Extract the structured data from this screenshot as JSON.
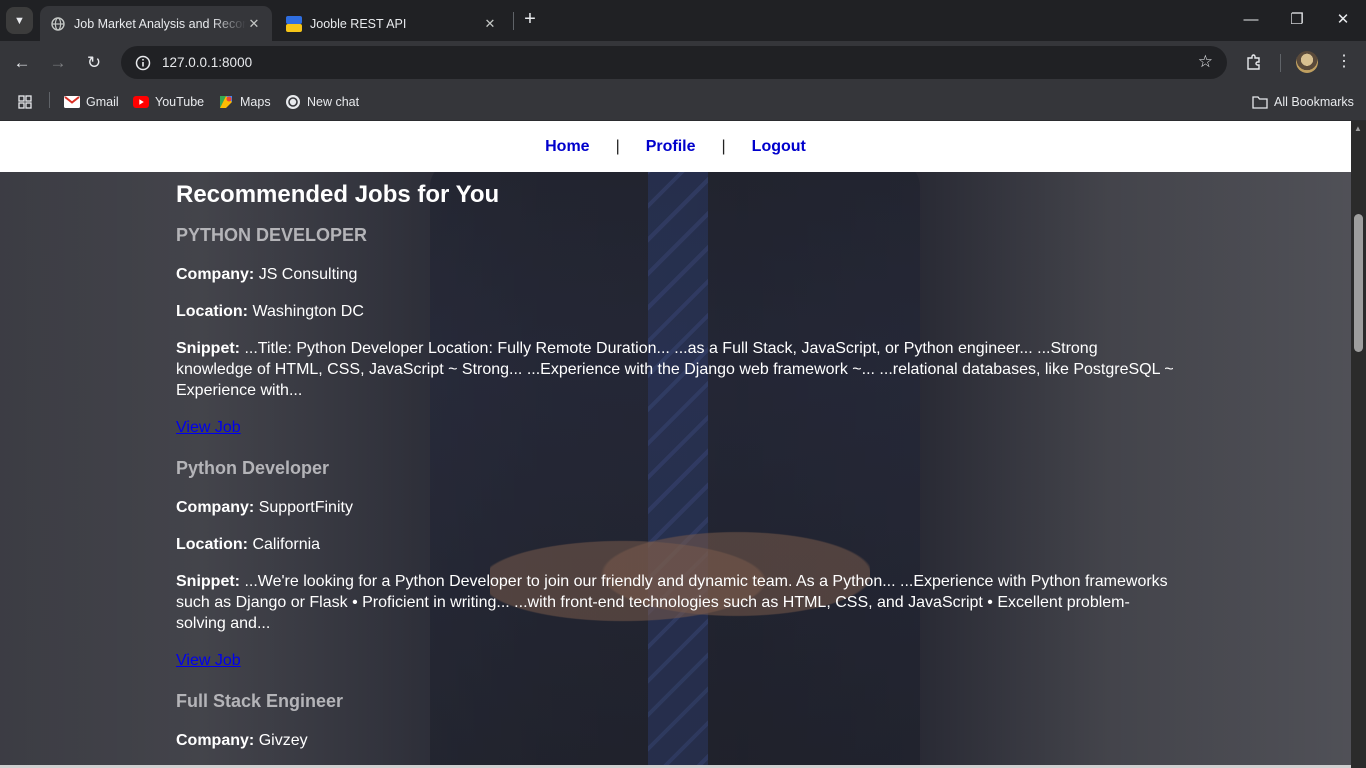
{
  "browser": {
    "tabs": [
      {
        "title": "Job Market Analysis and Recommendations",
        "active": true
      },
      {
        "title": "Jooble REST API",
        "active": false
      }
    ],
    "url": "127.0.0.1:8000",
    "bookmarks": [
      {
        "label": "Gmail",
        "icon": "gmail-icon"
      },
      {
        "label": "YouTube",
        "icon": "youtube-icon"
      },
      {
        "label": "Maps",
        "icon": "maps-icon"
      },
      {
        "label": "New chat",
        "icon": "chatgpt-icon"
      }
    ],
    "all_bookmarks": "All Bookmarks"
  },
  "nav": {
    "home": "Home",
    "profile": "Profile",
    "logout": "Logout",
    "separator": "|"
  },
  "page": {
    "heading": "Recommended Jobs for You",
    "labels": {
      "company": "Company:",
      "location": "Location:",
      "snippet": "Snippet:",
      "view_job": "View Job"
    },
    "jobs": [
      {
        "title": "PYTHON DEVELOPER",
        "company": "JS Consulting",
        "location": "Washington DC",
        "snippet": "...Title: Python Developer Location: Fully Remote Duration... ...as a Full Stack, JavaScript, or Python engineer... ...Strong knowledge of HTML, CSS, JavaScript ~ Strong... ...Experience with the Django web framework ~... ...relational databases, like PostgreSQL ~ Experience with..."
      },
      {
        "title": "Python Developer",
        "company": "SupportFinity",
        "location": "California",
        "snippet": "...We're looking for a Python Developer to join our friendly and dynamic team. As a Python... ...Experience with Python frameworks such as Django or Flask • Proficient in writing... ...with front-end technologies such as HTML, CSS, and JavaScript • Excellent problem-solving and..."
      },
      {
        "title": "Full Stack Engineer",
        "company": "Givzey"
      }
    ]
  },
  "colors": {
    "nav_link": "#0000cc",
    "job_title": "#b4b4b8",
    "view_link": "#0000ee",
    "chrome_dark": "#202124",
    "chrome_toolbar": "#35363a"
  }
}
